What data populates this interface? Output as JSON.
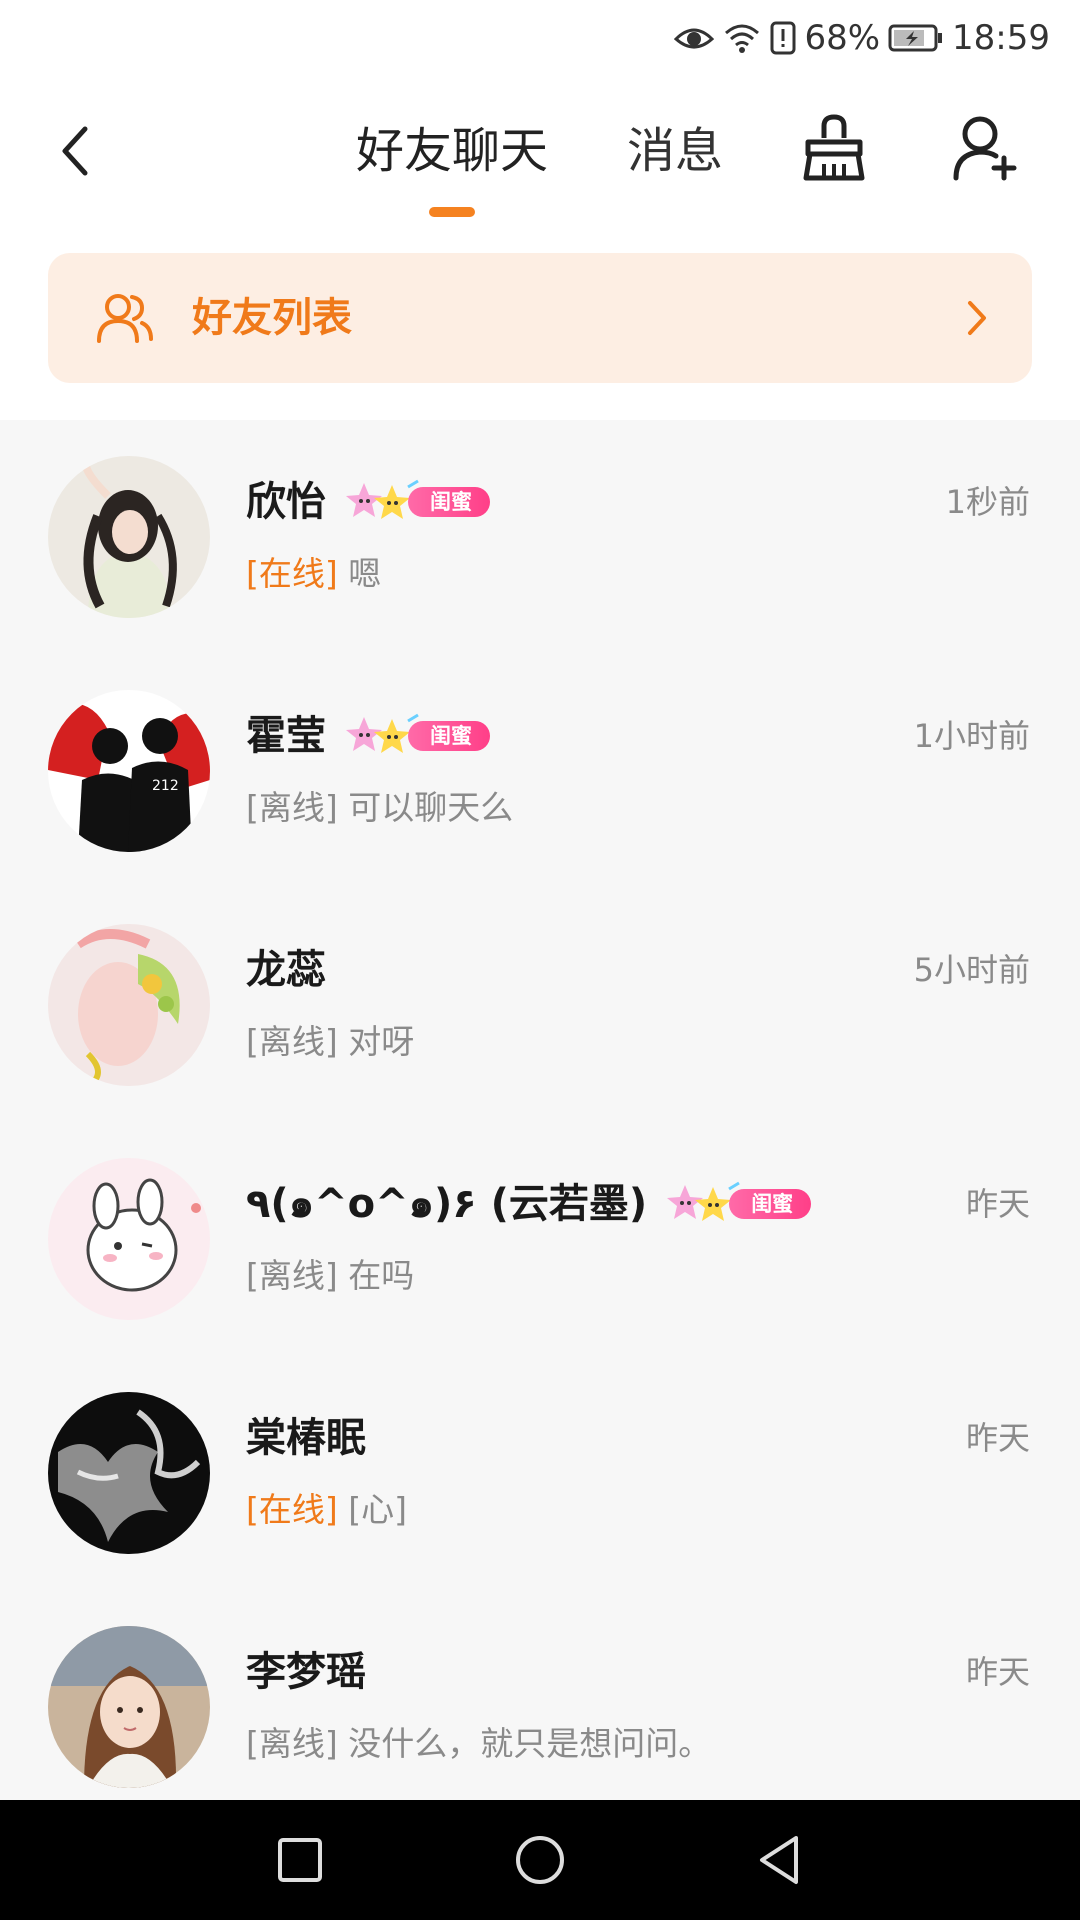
{
  "status_bar": {
    "icons": [
      "eye-icon",
      "wifi-icon",
      "alert-icon",
      "battery-icon"
    ],
    "battery": "68%",
    "time": "18:59"
  },
  "header": {
    "tabs": [
      {
        "label": "好友聊天",
        "active": true
      },
      {
        "label": "消息",
        "active": false
      }
    ],
    "icons": [
      "back-icon",
      "clean-icon",
      "add-friend-icon"
    ],
    "accent_color": "#f58220"
  },
  "friend_list_bar": {
    "label": "好友列表",
    "icon": "friends-icon"
  },
  "chats": [
    {
      "name": "欣怡",
      "badge": "闺蜜",
      "time": "1秒前",
      "status": "[在线]",
      "online": true,
      "message": "嗯"
    },
    {
      "name": "霍莹",
      "badge": "闺蜜",
      "time": "1小时前",
      "status": "[离线]",
      "online": false,
      "message": "可以聊天么"
    },
    {
      "name": "龙蕊",
      "badge": "",
      "time": "5小时前",
      "status": "[离线]",
      "online": false,
      "message": "对呀"
    },
    {
      "name": "٩(๑^o^๑)۶ (云若墨)",
      "badge": "闺蜜",
      "time": "昨天",
      "status": "[离线]",
      "online": false,
      "message": "在吗"
    },
    {
      "name": "棠椿眠",
      "badge": "",
      "time": "昨天",
      "status": "[在线]",
      "online": true,
      "message": "[心]"
    },
    {
      "name": "李梦瑶",
      "badge": "",
      "time": "昨天",
      "status": "[离线]",
      "online": false,
      "message": "没什么，就只是想问问。"
    }
  ],
  "colors": {
    "online": "#f07a1a",
    "offline": "#8a8a8a",
    "badge_pink": "#ff3f88"
  }
}
